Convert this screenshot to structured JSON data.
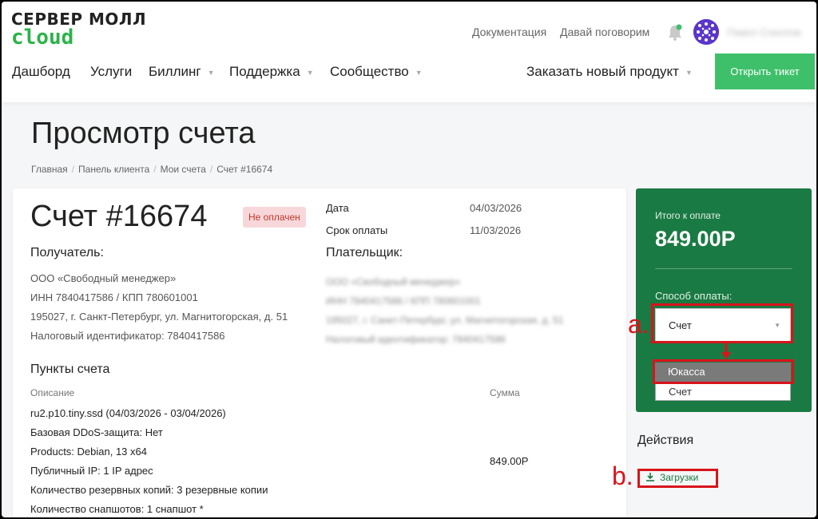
{
  "logo": {
    "top": "СЕРВЕР МОЛЛ",
    "bottom": "cloud"
  },
  "header": {
    "docs": "Документация",
    "talk": "Давай поговорим",
    "user_name": "Павел Соколов"
  },
  "nav": {
    "items": [
      "Дашборд",
      "Услуги",
      "Биллинг",
      "Поддержка",
      "Сообщество"
    ],
    "order": "Заказать новый продукт",
    "ticket": "Открыть тикет"
  },
  "page": {
    "title": "Просмотр счета",
    "breadcrumb": [
      "Главная",
      "Панель клиента",
      "Мои счета",
      "Счет #16674"
    ]
  },
  "invoice": {
    "title": "Счет #16674",
    "status": "Не оплачен",
    "date_label": "Дата",
    "date": "04/03/2026",
    "due_label": "Срок оплаты",
    "due": "11/03/2026",
    "recipient_label": "Получатель:",
    "recipient": [
      "ООО «Свободный менеджер»",
      "ИНН 7840417586 / КПП 780601001",
      "195027, г. Санкт-Петербург, ул. Магнитогорская, д. 51",
      "Налоговый идентификатор: 7840417586"
    ],
    "payer_label": "Плательщик:",
    "payer": [
      "ООО «Свободный менеджер»",
      "ИНН 7840417586 / КПП 780601001",
      "195027, г. Санкт-Петербург, ул. Магнитогорская, д. 51",
      "Налоговый идентификатор: 7840417586"
    ],
    "items_title": "Пункты счета",
    "col_desc": "Описание",
    "col_sum": "Сумма",
    "items": [
      "ru2.p10.tiny.ssd (04/03/2026 - 03/04/2026)",
      "Базовая DDoS-защита: Нет",
      "Products: Debian, 13 x64",
      "Публичный IP: 1 IP адрес",
      "Количество резервных копий: 3 резервные копии",
      "Количество снапшотов: 1 снапшот *"
    ],
    "amount": "849.00Р"
  },
  "payment": {
    "total_label": "Итого к оплате",
    "total": "849.00Р",
    "method_label": "Способ оплаты:",
    "selected": "Счет",
    "options": [
      "Юкасса",
      "Счет"
    ]
  },
  "actions": {
    "title": "Действия",
    "download": "Загрузки"
  },
  "annotations": {
    "a": "a.",
    "b": "b."
  },
  "colors": {
    "brand_green": "#1a7a43",
    "button_green": "#3ec06a",
    "annotation_red": "#d8141b"
  }
}
